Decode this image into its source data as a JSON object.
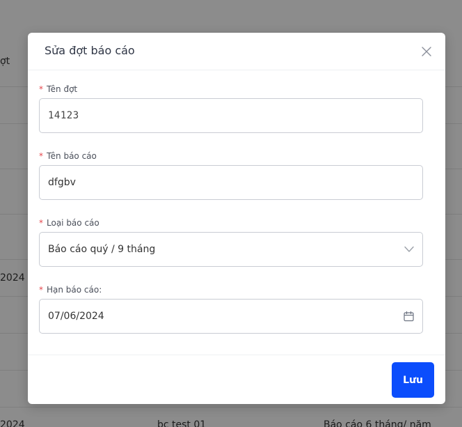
{
  "background": {
    "header_fragment": "ợt",
    "row_year_1": "2024",
    "row_year_2": "2024",
    "row_name": "bc test 01",
    "row_type": "Báo cáo 6 tháng/ năm"
  },
  "modal": {
    "title": "Sửa đợt báo cáo",
    "close_icon": "close-icon",
    "fields": {
      "ten_dot": {
        "label": "Tên đợt",
        "required": true,
        "value": "14123"
      },
      "ten_bao_cao": {
        "label": "Tên báo cáo",
        "required": true,
        "value": "dfgbv"
      },
      "loai_bao_cao": {
        "label": "Loại báo cáo",
        "required": true,
        "value": "Báo cáo quý / 9 tháng",
        "icon": "chevron-down-icon"
      },
      "han_bao_cao": {
        "label": "Hạn báo cáo:",
        "required": true,
        "value": "07/06/2024",
        "icon": "calendar-icon"
      }
    },
    "required_mark": "*",
    "save_label": "Lưu",
    "colors": {
      "primary": "#0b4dfc",
      "required": "#e5484d"
    }
  }
}
